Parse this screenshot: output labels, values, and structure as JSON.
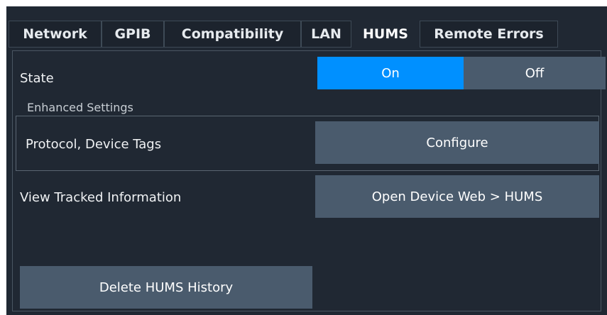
{
  "tabs": [
    {
      "label": "Network"
    },
    {
      "label": "GPIB"
    },
    {
      "label": "Compatibility"
    },
    {
      "label": "LAN"
    },
    {
      "label": "HUMS"
    },
    {
      "label": "Remote Errors"
    }
  ],
  "active_tab": "HUMS",
  "state": {
    "label": "State",
    "on_label": "On",
    "off_label": "Off",
    "value": "On"
  },
  "enhanced": {
    "title": "Enhanced Settings",
    "protocol_label": "Protocol, Device Tags",
    "configure_label": "Configure"
  },
  "view": {
    "label": "View Tracked Information",
    "button_label": "Open Device Web > HUMS"
  },
  "delete_label": "Delete HUMS History",
  "colors": {
    "accent": "#0090ff",
    "button": "#4a5b6d",
    "background": "#202833"
  }
}
